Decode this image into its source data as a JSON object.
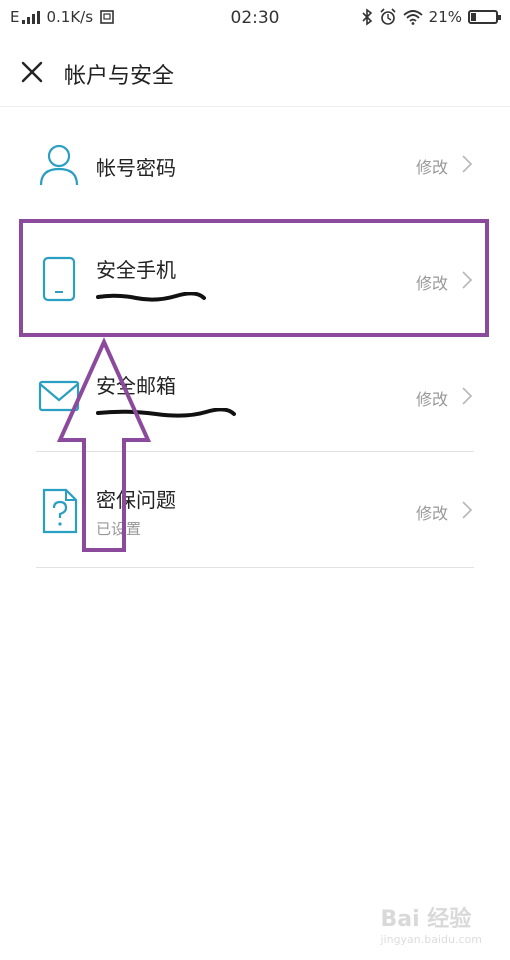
{
  "status_bar": {
    "network": "E",
    "speed": "0.1K/s",
    "time": "02:30",
    "battery": "21%",
    "battery_level": 0.21
  },
  "header": {
    "title": "帐户与安全"
  },
  "items": [
    {
      "title": "帐号密码",
      "subtitle": "",
      "action": "修改",
      "icon": "user-icon"
    },
    {
      "title": "安全手机",
      "subtitle": "",
      "action": "修改",
      "icon": "phone-icon"
    },
    {
      "title": "安全邮箱",
      "subtitle": "",
      "action": "修改",
      "icon": "mail-icon"
    },
    {
      "title": "密保问题",
      "subtitle": "已设置",
      "action": "修改",
      "icon": "question-file-icon"
    }
  ],
  "colors": {
    "accent": "#2a9fc1",
    "annotation": "#8b4a9c",
    "text": "#222222",
    "muted": "#999999"
  },
  "watermark": {
    "brand": "Bai 经验",
    "url": "jingyan.baidu.com"
  }
}
